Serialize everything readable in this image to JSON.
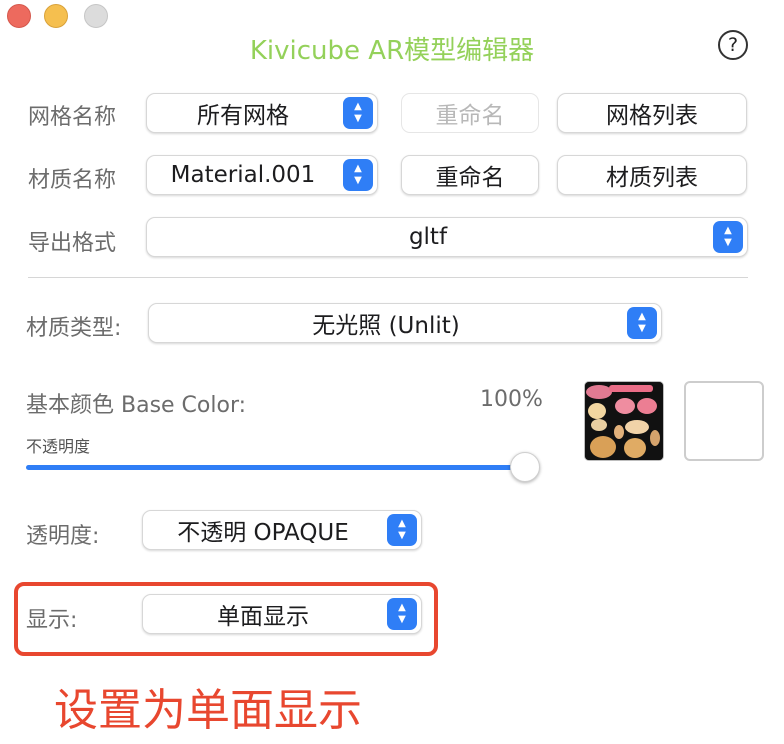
{
  "window": {
    "title": "Kivicube AR模型编辑器",
    "help": "?"
  },
  "mesh": {
    "label": "网格名称",
    "selected": "所有网格",
    "rename": "重命名",
    "list": "网格列表"
  },
  "material": {
    "label": "材质名称",
    "selected": "Material.001",
    "rename": "重命名",
    "list": "材质列表"
  },
  "export": {
    "label": "导出格式",
    "selected": "gltf"
  },
  "material_type": {
    "label": "材质类型:",
    "selected": "无光照 (Unlit)"
  },
  "base_color": {
    "label": "基本颜色 Base Color:",
    "percent": "100%",
    "opacity_label": "不透明度",
    "opacity_value": 1.0
  },
  "transparency": {
    "label": "透明度:",
    "selected": "不透明 OPAQUE"
  },
  "display": {
    "label": "显示:",
    "selected": "单面显示"
  },
  "annotation": {
    "text": "设置为单面显示",
    "color": "#e8472f"
  },
  "colors": {
    "accent": "#2f7ef6",
    "title": "#94d15a",
    "highlight": "#e8472f"
  }
}
